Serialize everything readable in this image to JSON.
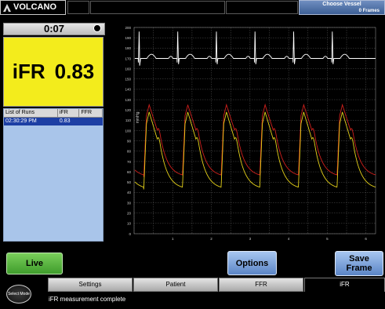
{
  "header": {
    "brand": "VOLCANO",
    "vessel_label": "Choose Vessel",
    "frames_label": "0 Frames"
  },
  "timer": {
    "value": "0:07"
  },
  "measurement": {
    "label": "iFR",
    "value": "0.83"
  },
  "runs": {
    "headers": [
      "List of Runs",
      "iFR",
      "FFR"
    ],
    "rows": [
      {
        "time": "02:30:29 PM",
        "ifr": "0.83",
        "ffr": ""
      }
    ]
  },
  "buttons": {
    "live": "Live",
    "options": "Options",
    "save_frame": "Save Frame"
  },
  "select_mode": "Select Mode",
  "tabs": [
    {
      "label": "Settings",
      "active": false
    },
    {
      "label": "Patient",
      "active": false
    },
    {
      "label": "FFR",
      "active": false
    },
    {
      "label": "iFR",
      "active": true
    }
  ],
  "status": "iFR measurement complete",
  "colors": {
    "ecg": "#ffffff",
    "pa": "#d0201c",
    "pd": "#e6d21a",
    "yellow_panel": "#f3ec1c",
    "runs_panel": "#a9c5ea"
  },
  "chart_data": {
    "type": "line",
    "ylabel": "mmHg",
    "yticks": [
      0,
      10,
      20,
      30,
      40,
      50,
      60,
      70,
      80,
      90,
      100,
      110,
      120,
      130,
      140,
      150,
      160,
      170,
      180,
      190,
      200
    ],
    "xticks": [
      1,
      2,
      3,
      4,
      5,
      6
    ],
    "ylim": [
      0,
      200
    ],
    "xlim": [
      0,
      6.25
    ],
    "grid": true,
    "beats": [
      0.25,
      1.25,
      2.25,
      3.25,
      4.25,
      5.25
    ],
    "series": [
      {
        "key": "pa",
        "peak": 125,
        "trough": 55
      },
      {
        "key": "pd",
        "peak": 118,
        "trough": 43
      },
      {
        "key": "ecg",
        "baseline": 170,
        "peak": 196,
        "dip": 163
      }
    ]
  }
}
